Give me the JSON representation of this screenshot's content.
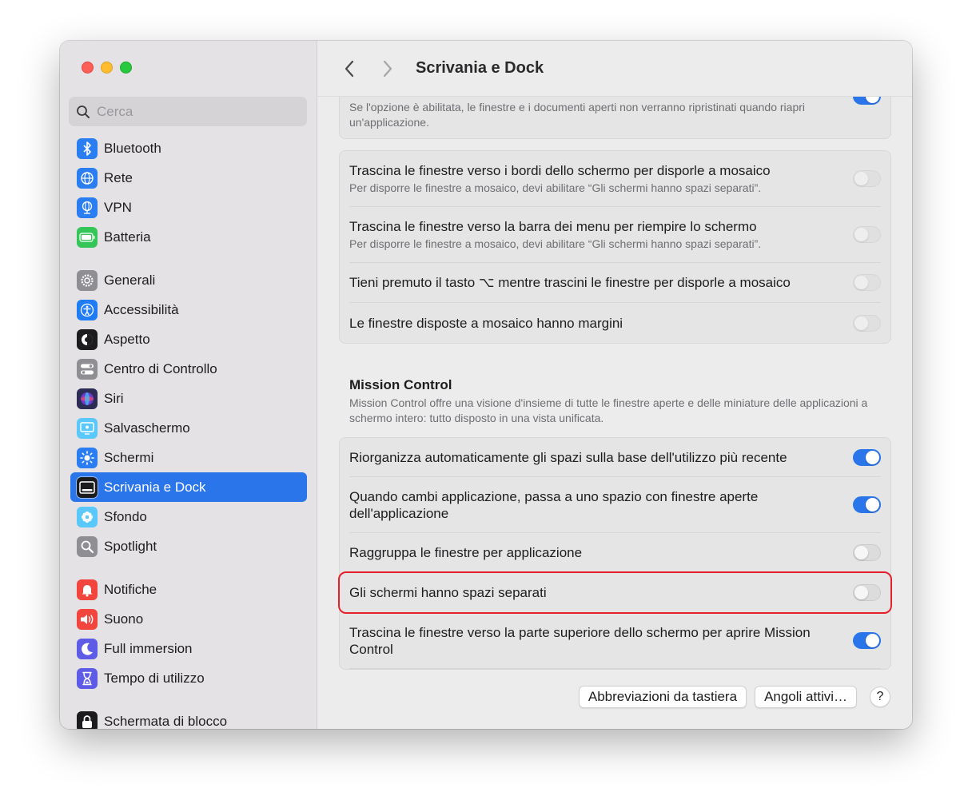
{
  "window": {
    "title": "Scrivania e Dock"
  },
  "search": {
    "placeholder": "Cerca"
  },
  "sidebar": {
    "groups": [
      [
        {
          "label": "Bluetooth",
          "icon": "bluetooth-icon",
          "color": "#2a7ef2"
        },
        {
          "label": "Rete",
          "icon": "globe-icon",
          "color": "#2a7ef2"
        },
        {
          "label": "VPN",
          "icon": "vpn-globe-icon",
          "color": "#2a7ef2"
        },
        {
          "label": "Batteria",
          "icon": "battery-icon",
          "color": "#35c659"
        }
      ],
      [
        {
          "label": "Generali",
          "icon": "gear-icon",
          "color": "#8e8e93"
        },
        {
          "label": "Accessibilità",
          "icon": "accessibility-icon",
          "color": "#1f7cf5"
        },
        {
          "label": "Aspetto",
          "icon": "appearance-icon",
          "color": "#1c1c1e"
        },
        {
          "label": "Centro di Controllo",
          "icon": "control-center-icon",
          "color": "#8e8e93"
        },
        {
          "label": "Siri",
          "icon": "siri-icon",
          "color": "#2c2c55"
        },
        {
          "label": "Salvaschermo",
          "icon": "screensaver-icon",
          "color": "#5ac8fa"
        },
        {
          "label": "Schermi",
          "icon": "sun-icon",
          "color": "#2a7ef2"
        },
        {
          "label": "Scrivania e Dock",
          "icon": "dock-icon",
          "color": "#1c1c1e",
          "active": true
        },
        {
          "label": "Sfondo",
          "icon": "flower-icon",
          "color": "#5ac8fa"
        },
        {
          "label": "Spotlight",
          "icon": "magnifier-icon",
          "color": "#8e8e93"
        }
      ],
      [
        {
          "label": "Notifiche",
          "icon": "bell-icon",
          "color": "#f2453d"
        },
        {
          "label": "Suono",
          "icon": "speaker-icon",
          "color": "#f2453d"
        },
        {
          "label": "Full immersion",
          "icon": "moon-icon",
          "color": "#5e5ce6"
        },
        {
          "label": "Tempo di utilizzo",
          "icon": "hourglass-icon",
          "color": "#5e5ce6"
        }
      ],
      [
        {
          "label": "Schermata di blocco",
          "icon": "lock-icon",
          "color": "#1c1c1e"
        }
      ]
    ]
  },
  "top_card": {
    "sub": "Se l'opzione è abilitata, le finestre e i documenti aperti non verranno ripristinati quando riapri un'applicazione.",
    "toggle_on": true
  },
  "tiling_card": [
    {
      "label": "Trascina le finestre verso i bordi dello schermo per disporle a mosaico",
      "sub": "Per disporre le finestre a mosaico, devi abilitare “Gli schermi hanno spazi separati”.",
      "on": false
    },
    {
      "label": "Trascina le finestre verso la barra dei menu per riempire lo schermo",
      "sub": "Per disporre le finestre a mosaico, devi abilitare “Gli schermi hanno spazi separati”.",
      "on": false
    },
    {
      "label": "Tieni premuto il tasto ⌥ mentre trascini le finestre per disporle a mosaico",
      "sub": "",
      "on": false
    },
    {
      "label": "Le finestre disposte a mosaico hanno margini",
      "sub": "",
      "on": false
    }
  ],
  "mission_control": {
    "title": "Mission Control",
    "description": "Mission Control offre una visione d'insieme di tutte le finestre aperte e delle miniature delle applicazioni a schermo intero: tutto disposto in una vista unificata.",
    "rows": [
      {
        "label": "Riorganizza automaticamente gli spazi sulla base dell'utilizzo più recente",
        "on": true
      },
      {
        "label": "Quando cambi applicazione, passa a uno spazio con finestre aperte dell'applicazione",
        "on": true
      },
      {
        "label": "Raggruppa le finestre per applicazione",
        "on": false
      },
      {
        "label": "Gli schermi hanno spazi separati",
        "on": false,
        "highlighted": true
      },
      {
        "label": "Trascina le finestre verso la parte superiore dello schermo per aprire Mission Control",
        "on": true
      }
    ]
  },
  "buttons": {
    "shortcuts": "Abbreviazioni da tastiera",
    "hot_corners": "Angoli attivi…",
    "help": "?"
  },
  "colors": {
    "accent": "#2a75ea",
    "highlight": "#e5202b"
  }
}
